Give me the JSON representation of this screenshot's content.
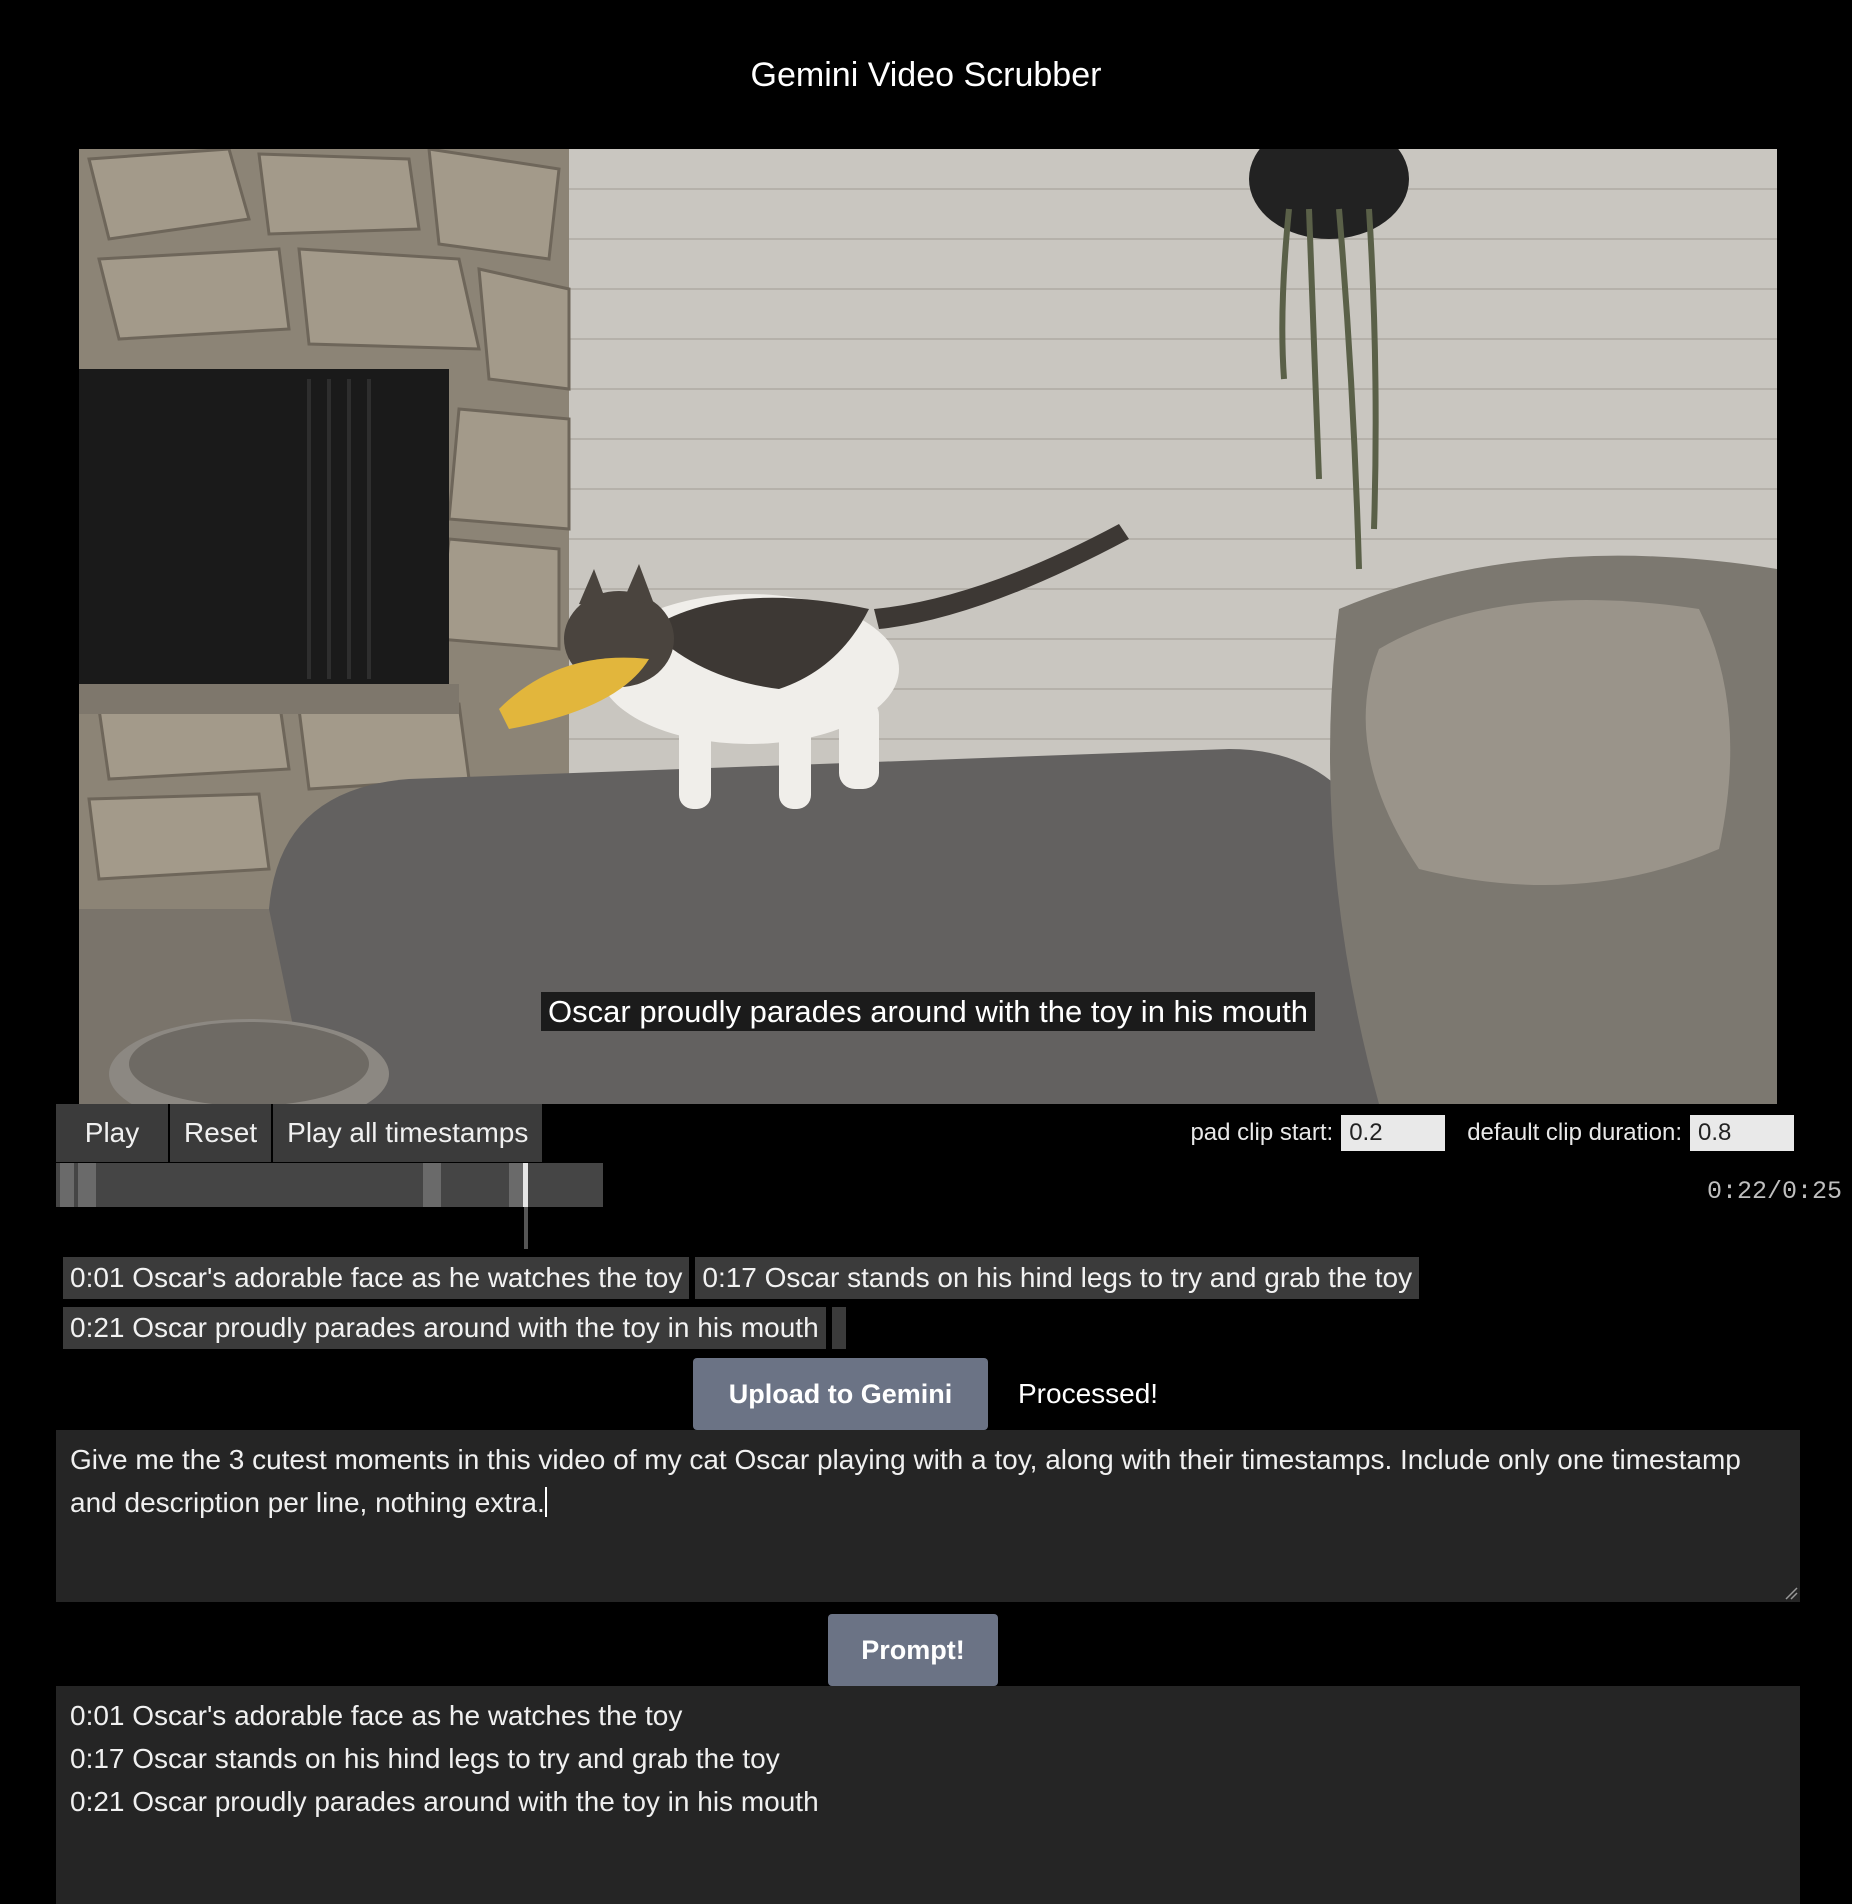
{
  "app": {
    "title": "Gemini Video Scrubber"
  },
  "video": {
    "caption": "Oscar proudly parades around with the toy in his mouth",
    "current_time": "0:22/0:25",
    "progress": 0.88
  },
  "controls": {
    "play_label": "Play",
    "reset_label": "Reset",
    "play_all_label": "Play all timestamps",
    "pad_clip_start_label": "pad clip start:",
    "pad_clip_start_value": "0.2",
    "default_clip_duration_label": "default clip duration:",
    "default_clip_duration_value": "0.8"
  },
  "timestamps": [
    {
      "label": "0:01 Oscar's adorable face as he watches the toy"
    },
    {
      "label": "0:17 Oscar stands on his hind legs to try and grab the toy"
    },
    {
      "label": "0:21 Oscar proudly parades around with the toy in his mouth"
    },
    {
      "label": ""
    }
  ],
  "upload": {
    "button_label": "Upload to Gemini",
    "status": "Processed!"
  },
  "prompt": {
    "text": "Give me the 3 cutest moments in this video of my cat Oscar playing with a toy, along with their timestamps. Include only one timestamp and description per line, nothing extra.",
    "button_label": "Prompt!"
  },
  "response": {
    "lines": [
      "0:01 Oscar's adorable face as he watches the toy",
      "0:17 Oscar stands on his hind legs to try and grab the toy",
      "0:21 Oscar proudly parades around with the toy in his mouth"
    ]
  }
}
